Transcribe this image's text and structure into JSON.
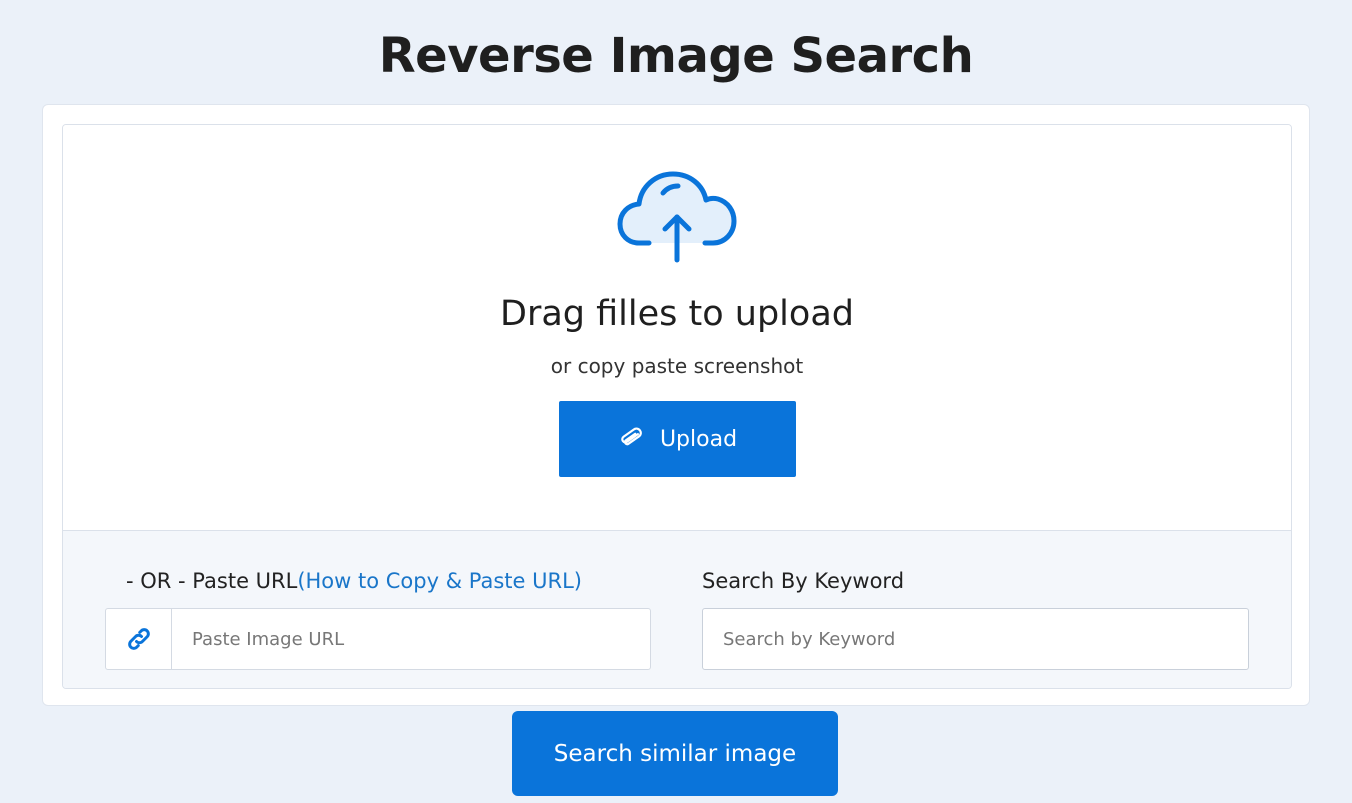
{
  "page": {
    "title": "Reverse Image Search"
  },
  "dropzone": {
    "icon": "cloud-upload-icon",
    "title": "Drag filles to upload",
    "subtitle": "or copy paste screenshot",
    "upload_icon": "paperclip-icon",
    "upload_label": "Upload"
  },
  "url_section": {
    "label_prefix": "- OR - Paste URL",
    "help_link": "(How to Copy & Paste URL)",
    "icon": "link-icon",
    "placeholder": "Paste Image URL",
    "value": ""
  },
  "keyword_section": {
    "label": "Search By Keyword",
    "placeholder": "Search by Keyword",
    "value": ""
  },
  "actions": {
    "search_label": "Search similar image"
  },
  "colors": {
    "accent": "#0a74da",
    "link": "#1a76c9",
    "background": "#ebf1f9"
  }
}
